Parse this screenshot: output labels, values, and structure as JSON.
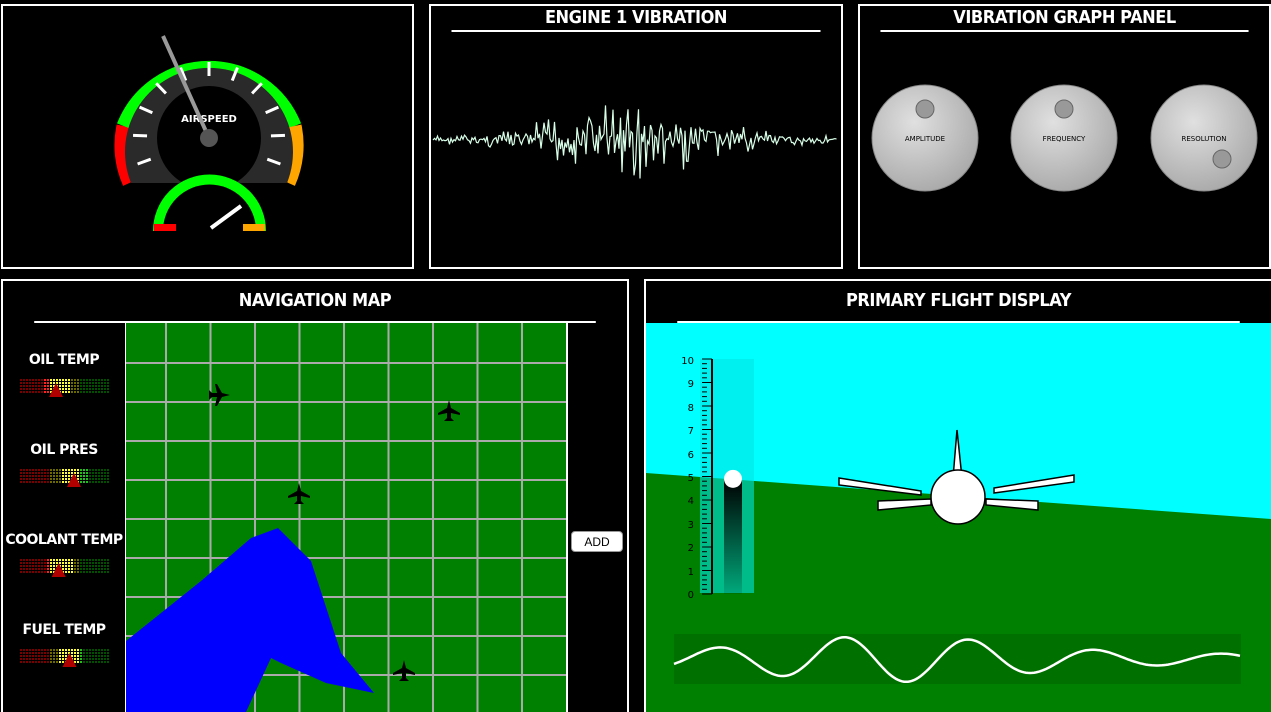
{
  "airspeed": {
    "label": "AIRSPEED"
  },
  "vibration": {
    "title": "ENGINE 1 VIBRATION"
  },
  "graph_panel": {
    "title": "VIBRATION GRAPH PANEL",
    "knobs": [
      {
        "label": "AMPLITUDE"
      },
      {
        "label": "FREQUENCY"
      },
      {
        "label": "RESOLUTION"
      }
    ]
  },
  "nav": {
    "title": "NAVIGATION MAP",
    "add_label": "ADD",
    "gauges": [
      {
        "label": "OIL TEMP",
        "level": 0.4
      },
      {
        "label": "OIL PRES",
        "level": 0.6
      },
      {
        "label": "COOLANT TEMP",
        "level": 0.43
      },
      {
        "label": "FUEL TEMP",
        "level": 0.55
      }
    ],
    "colors": {
      "map": "#008000",
      "water": "#0000ff",
      "grid": "#aaaaaa"
    }
  },
  "pfd": {
    "title": "PRIMARY FLIGHT DISPLAY",
    "scale_labels": [
      "10",
      "9",
      "8",
      "7",
      "6",
      "5",
      "4",
      "3",
      "2",
      "1",
      "0"
    ],
    "altitude_value": 4.9,
    "colors": {
      "sky": "#00ffff",
      "ground": "#008000"
    }
  }
}
